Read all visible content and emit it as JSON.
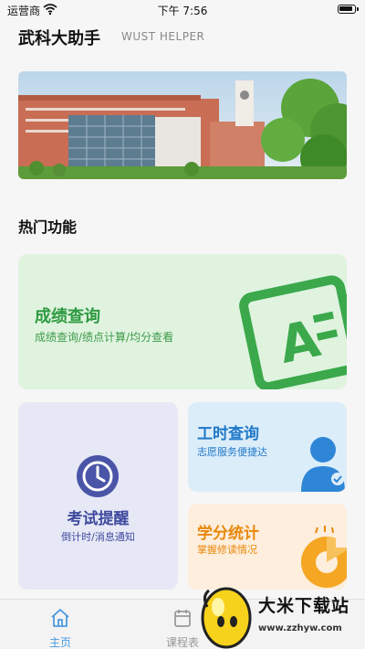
{
  "status": {
    "carrier": "运营商",
    "time": "下午 7:56"
  },
  "header": {
    "title": "武科大助手",
    "subtitle": "WUST HELPER"
  },
  "section": {
    "title": "热门功能"
  },
  "cards": {
    "grades": {
      "title": "成绩查询",
      "subtitle": "成绩查询/绩点计算/均分查看",
      "color": "#2e9a40"
    },
    "exam": {
      "title": "考试提醒",
      "subtitle": "倒计时/消息通知",
      "color": "#3f4a9e"
    },
    "hours": {
      "title": "工时查询",
      "subtitle": "志愿服务便捷达",
      "color": "#1e78c8"
    },
    "credits": {
      "title": "学分统计",
      "subtitle": "掌握修读情况",
      "color": "#e8890c"
    }
  },
  "tabs": [
    {
      "label": "主页",
      "icon": "home-icon",
      "active": true
    },
    {
      "label": "课程表",
      "icon": "calendar-icon",
      "active": false
    }
  ],
  "watermark": {
    "text": "大米下载站",
    "url": "www.zzhyw.com"
  }
}
